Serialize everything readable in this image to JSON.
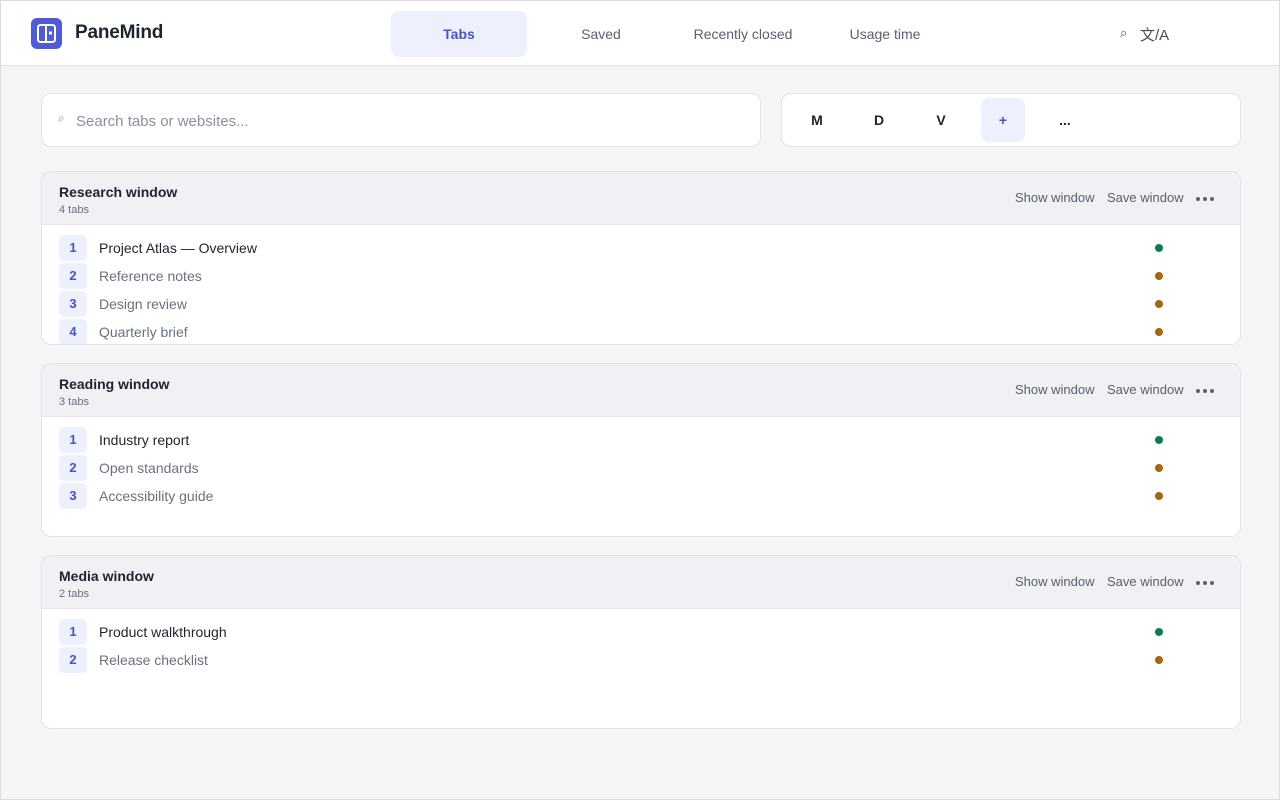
{
  "app": {
    "brand": "PaneMind"
  },
  "nav": {
    "tabs": [
      {
        "label": "Tabs"
      },
      {
        "label": "Saved"
      },
      {
        "label": "Recently closed"
      },
      {
        "label": "Usage time"
      }
    ],
    "search_icon": "⌕",
    "language_label": "文/A"
  },
  "search": {
    "icon": "⌕",
    "placeholder": "Search tabs or websites..."
  },
  "filters": {
    "chips": [
      {
        "label": "M"
      },
      {
        "label": "D"
      },
      {
        "label": "V"
      },
      {
        "label": "+"
      },
      {
        "label": "..."
      }
    ]
  },
  "windows": [
    {
      "title": "Research window",
      "count": "4 tabs",
      "show_label": "Show window",
      "save_label": "Save window",
      "tabs": [
        {
          "num": "1",
          "title": "Project Atlas — Overview",
          "status": "active"
        },
        {
          "num": "2",
          "title": "Reference notes",
          "status": "idle"
        },
        {
          "num": "3",
          "title": "Design review",
          "status": "idle"
        },
        {
          "num": "4",
          "title": "Quarterly brief",
          "status": "idle"
        }
      ]
    },
    {
      "title": "Reading window",
      "count": "3 tabs",
      "show_label": "Show window",
      "save_label": "Save window",
      "tabs": [
        {
          "num": "1",
          "title": "Industry report",
          "status": "active"
        },
        {
          "num": "2",
          "title": "Open standards",
          "status": "idle"
        },
        {
          "num": "3",
          "title": "Accessibility guide",
          "status": "idle"
        }
      ]
    },
    {
      "title": "Media window",
      "count": "2 tabs",
      "show_label": "Show window",
      "save_label": "Save window",
      "tabs": [
        {
          "num": "1",
          "title": "Product walkthrough",
          "status": "active"
        },
        {
          "num": "2",
          "title": "Release checklist",
          "status": "idle"
        }
      ]
    }
  ],
  "colors": {
    "accent": "#4f5bd5",
    "status_active": "#0f7a55",
    "status_idle": "#a8650a"
  }
}
